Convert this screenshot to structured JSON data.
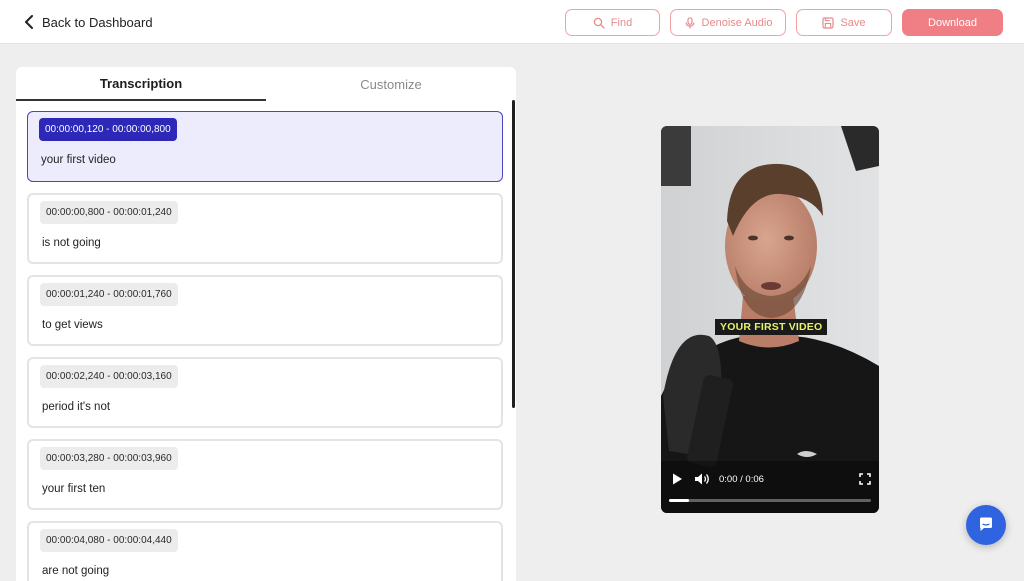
{
  "header": {
    "back_label": "Back to Dashboard",
    "buttons": {
      "find": "Find",
      "denoise": "Denoise Audio",
      "save": "Save",
      "download": "Download"
    }
  },
  "tabs": [
    "Transcription",
    "Customize"
  ],
  "active_tab": "Transcription",
  "segments": [
    {
      "time": "00:00:00,120 - 00:00:00,800",
      "text": "your first video",
      "selected": true
    },
    {
      "time": "00:00:00,800 - 00:00:01,240",
      "text": "is not going",
      "selected": false
    },
    {
      "time": "00:00:01,240 - 00:00:01,760",
      "text": "to get views",
      "selected": false
    },
    {
      "time": "00:00:02,240 - 00:00:03,160",
      "text": "period it's not",
      "selected": false
    },
    {
      "time": "00:00:03,280 - 00:00:03,960",
      "text": "your first ten",
      "selected": false
    },
    {
      "time": "00:00:04,080 - 00:00:04,440",
      "text": "are not going",
      "selected": false
    }
  ],
  "video": {
    "caption": "YOUR FIRST VIDEO",
    "time_display": "0:00 / 0:06",
    "progress": 0.1
  },
  "colors": {
    "accent": "#ef7f84",
    "selected": "#2d28b8",
    "chat": "#2f63df"
  }
}
